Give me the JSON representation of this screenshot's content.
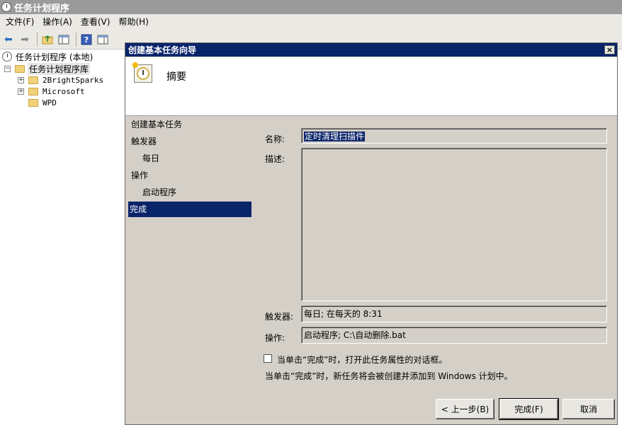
{
  "window": {
    "title": "任务计划程序"
  },
  "menu": [
    "文件(F)",
    "操作(A)",
    "查看(V)",
    "帮助(H)"
  ],
  "toolbar": {
    "icons": [
      "back-arrow-icon",
      "forward-arrow-icon",
      "up-folder-icon",
      "console-tree-icon",
      "help-icon",
      "action-pane-icon"
    ]
  },
  "tree": {
    "root": "任务计划程序 (本地)",
    "library": "任务计划程序库",
    "children": [
      "2BrightSparks",
      "Microsoft",
      "WPD"
    ]
  },
  "dialog": {
    "title": "创建基本任务向导",
    "close": "×",
    "header": "摘要",
    "steps": [
      {
        "label": "创建基本任务"
      },
      {
        "label": "触发器"
      },
      {
        "label": "每日"
      },
      {
        "label": "操作"
      },
      {
        "label": "启动程序"
      },
      {
        "label": "完成"
      }
    ],
    "name_label": "名称:",
    "name_value": "定时清理扫描件",
    "desc_label": "描述:",
    "desc_value": "",
    "trigger_label": "触发器:",
    "trigger_value": "每日; 在每天的 8:31",
    "action_label": "操作:",
    "action_value": "启动程序; C:\\自动删除.bat",
    "checkbox_label": "当单击“完成”时，打开此任务属性的对话框。",
    "checkbox_checked": false,
    "note": "当单击“完成”时，新任务将会被创建并添加到 Windows 计划中。",
    "buttons": {
      "back": "< 上一步(B)",
      "finish": "完成(F)",
      "cancel": "取消"
    }
  }
}
